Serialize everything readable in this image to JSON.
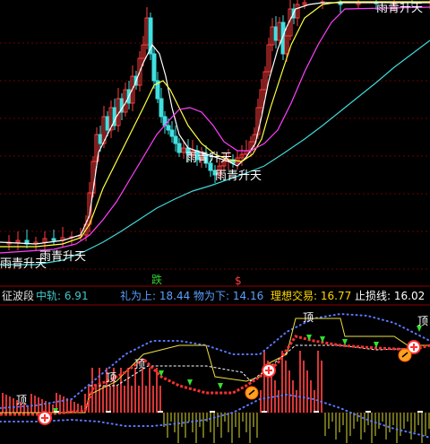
{
  "chart_data": [
    {
      "type": "candlestick",
      "panel": "price",
      "colors": {
        "up": "#ff3c3c",
        "down": "#40e0e0",
        "ma5": "#ffffff",
        "ma10": "#ffff40",
        "ma20": "#ff40ff",
        "ma60": "#40d8d8",
        "grid": "#6b0000"
      },
      "series": [
        {
          "name": "ma5",
          "points": [
            [
              0,
              270
            ],
            [
              40,
              272
            ],
            [
              70,
              268
            ],
            [
              90,
              262
            ],
            [
              100,
              240
            ],
            [
              110,
              170
            ],
            [
              120,
              150
            ],
            [
              130,
              130
            ],
            [
              140,
              115
            ],
            [
              150,
              95
            ],
            [
              160,
              70
            ],
            [
              170,
              50
            ],
            [
              178,
              60
            ],
            [
              185,
              85
            ],
            [
              192,
              120
            ],
            [
              200,
              150
            ],
            [
              210,
              165
            ],
            [
              225,
              170
            ],
            [
              240,
              175
            ],
            [
              255,
              180
            ],
            [
              265,
              185
            ],
            [
              275,
              175
            ],
            [
              285,
              160
            ],
            [
              292,
              130
            ],
            [
              300,
              90
            ],
            [
              310,
              55
            ],
            [
              320,
              30
            ],
            [
              330,
              10
            ],
            [
              345,
              5
            ],
            [
              360,
              3
            ],
            [
              480,
              3
            ]
          ]
        },
        {
          "name": "ma10",
          "points": [
            [
              0,
              275
            ],
            [
              40,
              275
            ],
            [
              70,
              272
            ],
            [
              90,
              265
            ],
            [
              100,
              250
            ],
            [
              115,
              210
            ],
            [
              130,
              180
            ],
            [
              145,
              150
            ],
            [
              160,
              120
            ],
            [
              172,
              95
            ],
            [
              182,
              90
            ],
            [
              190,
              100
            ],
            [
              200,
              120
            ],
            [
              210,
              140
            ],
            [
              225,
              160
            ],
            [
              240,
              172
            ],
            [
              255,
              178
            ],
            [
              270,
              180
            ],
            [
              282,
              172
            ],
            [
              292,
              155
            ],
            [
              302,
              120
            ],
            [
              315,
              80
            ],
            [
              325,
              50
            ],
            [
              340,
              20
            ],
            [
              360,
              5
            ],
            [
              380,
              2
            ],
            [
              480,
              2
            ]
          ]
        },
        {
          "name": "ma20",
          "points": [
            [
              0,
              282
            ],
            [
              30,
              280
            ],
            [
              60,
              278
            ],
            [
              85,
              272
            ],
            [
              100,
              262
            ],
            [
              115,
              245
            ],
            [
              130,
              225
            ],
            [
              145,
              200
            ],
            [
              160,
              175
            ],
            [
              175,
              150
            ],
            [
              188,
              135
            ],
            [
              200,
              122
            ],
            [
              212,
              120
            ],
            [
              225,
              125
            ],
            [
              238,
              140
            ],
            [
              250,
              158
            ],
            [
              265,
              168
            ],
            [
              280,
              168
            ],
            [
              295,
              160
            ],
            [
              310,
              145
            ],
            [
              325,
              115
            ],
            [
              340,
              80
            ],
            [
              355,
              50
            ],
            [
              370,
              25
            ],
            [
              385,
              10
            ],
            [
              480,
              8
            ]
          ]
        },
        {
          "name": "ma60",
          "points": [
            [
              0,
              295
            ],
            [
              40,
              295
            ],
            [
              70,
              290
            ],
            [
              95,
              280
            ],
            [
              115,
              270
            ],
            [
              135,
              258
            ],
            [
              155,
              245
            ],
            [
              175,
              232
            ],
            [
              195,
              222
            ],
            [
              215,
              213
            ],
            [
              235,
              207
            ],
            [
              255,
              200
            ],
            [
              275,
              193
            ],
            [
              295,
              185
            ],
            [
              315,
              172
            ],
            [
              340,
              155
            ],
            [
              360,
              140
            ],
            [
              380,
              124
            ],
            [
              400,
              108
            ],
            [
              420,
              92
            ],
            [
              440,
              75
            ],
            [
              460,
              60
            ],
            [
              480,
              45
            ]
          ]
        }
      ],
      "annotations": [
        "雨青升天",
        "雨青升天",
        "雨青升天",
        "雨青升天",
        "雨青升天"
      ],
      "signals": [
        "跌",
        "$"
      ]
    },
    {
      "type": "line",
      "panel": "indicator",
      "indicator_name": "征波段",
      "values": {
        "mid_rail_label": "中轨: 6.91",
        "upper_label": "礼为上: 18.44",
        "lower_label": "物为下: 14.16",
        "ideal_label": "理想交易: 16.77",
        "stop_label": "止损线: 16.02"
      },
      "marks": [
        "顶",
        "顶",
        "顶",
        "顶",
        "顶"
      ]
    }
  ],
  "header": {
    "indicator_name": "征波段",
    "mid_rail": "中轨: 6.91",
    "upper": "礼为上: 18.44",
    "lower": "物为下: 14.16",
    "ideal": "理想交易: 16.77",
    "stop": "止损线: 16.02"
  },
  "signals": {
    "die": "跌",
    "dollar": "$"
  }
}
